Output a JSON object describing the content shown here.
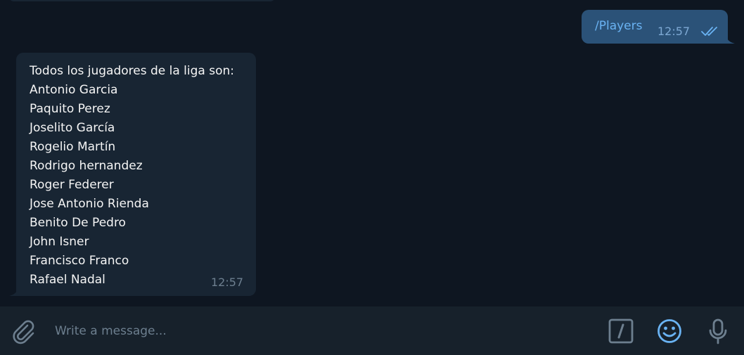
{
  "chat": {
    "outgoing": {
      "text": "/Players",
      "time": "12:57",
      "status_icon": "double-check-icon"
    },
    "incoming": {
      "header": "Todos los jugadores de la liga son:",
      "players": [
        "Antonio Garcia",
        "Paquito Perez",
        "Joselito García",
        "Rogelio Martín",
        "Rodrigo hernandez",
        "Roger Federer",
        "Jose Antonio Rienda",
        "Benito De Pedro",
        "John Isner",
        "Francisco Franco",
        "Rafael Nadal"
      ],
      "time": "12:57"
    }
  },
  "compose": {
    "placeholder": "Write a message...",
    "icons": [
      "paperclip-icon",
      "bot-commands-icon",
      "emoji-icon",
      "microphone-icon"
    ]
  },
  "colors": {
    "background": "#0e1621",
    "bubble_in": "#182533",
    "bubble_out": "#2b5278",
    "compose_bar": "#17212b",
    "accent": "#6ab3f3",
    "muted": "#6d7f8f"
  }
}
